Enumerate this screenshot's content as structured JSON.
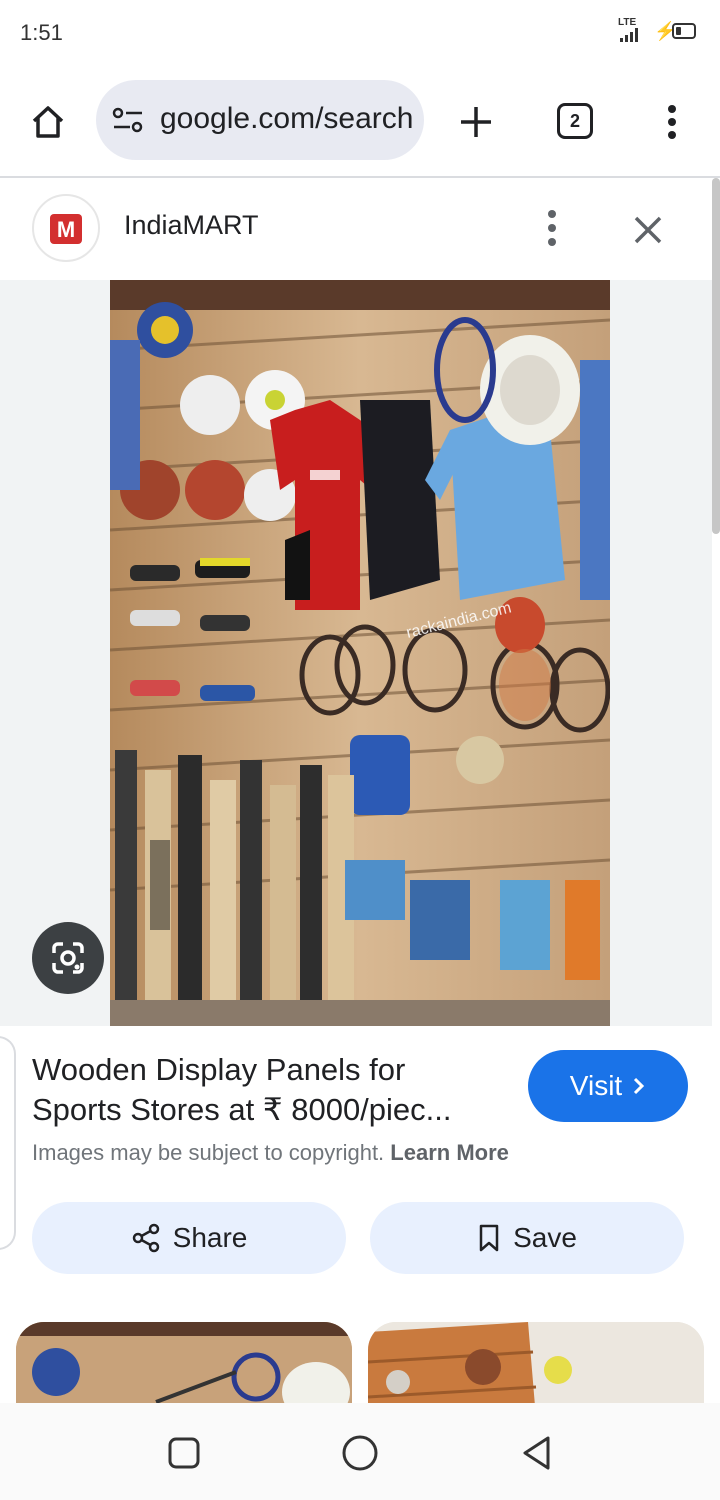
{
  "status_bar": {
    "time": "1:51",
    "network": "LTE"
  },
  "browser": {
    "url": "google.com/search",
    "tab_count": "2"
  },
  "panel": {
    "site_name": "IndiaMART",
    "logo_letter": "M",
    "watermark": "rackaindia.com"
  },
  "result": {
    "title_line1": "Wooden Display Panels for",
    "title_line2": "Sports Stores at ₹ 8000/piec...",
    "visit_label": "Visit",
    "copyright_text": "Images may be subject to copyright.",
    "learn_more": "Learn More",
    "share_label": "Share",
    "save_label": "Save"
  },
  "icons": {
    "home": "home-icon",
    "tune": "site-settings-icon",
    "add": "new-tab-icon",
    "more": "more-vert-icon",
    "close": "close-icon",
    "lens": "google-lens-icon",
    "share": "share-icon",
    "bookmark": "bookmark-icon",
    "chevron": "chevron-right-icon"
  },
  "colors": {
    "accent": "#1a73e8",
    "tonal_button": "#e8f0fe",
    "url_bar": "#e8eaf2"
  }
}
